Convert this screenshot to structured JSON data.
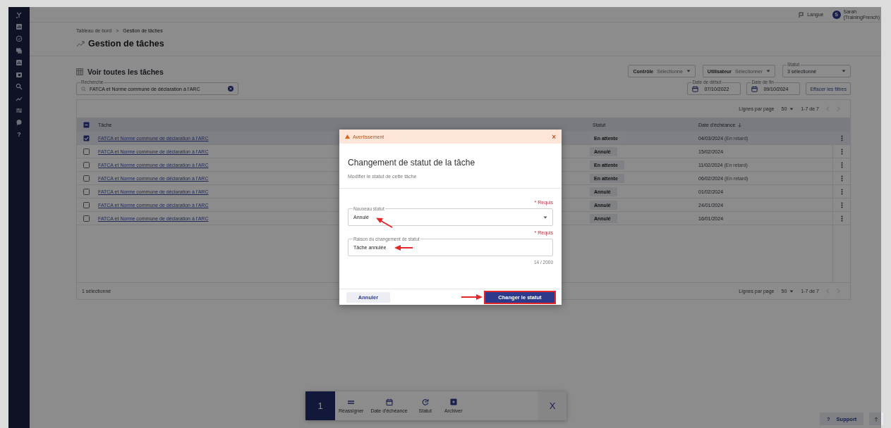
{
  "topbar": {
    "language": "Langue",
    "user": {
      "initial": "S",
      "name": "Sarah",
      "org": "(TrainingFrench)"
    }
  },
  "sidebar": {
    "help": "?"
  },
  "breadcrumb": {
    "items": [
      "Tableau de bord",
      "Gestion de tâches"
    ],
    "separator": ">"
  },
  "page_title": "Gestion de tâches",
  "section_title": "Voir toutes les tâches",
  "search": {
    "label": "Recherche",
    "value": "FATCA et Norme commune de déclaration à l'ARC"
  },
  "filters": [
    {
      "kind": "select",
      "label": "Contrôle",
      "value": "Sélectionne"
    },
    {
      "kind": "select",
      "label": "Utilisateur",
      "value": "Sélectionner"
    },
    {
      "kind": "floating",
      "label": "Statut",
      "value": "3 sélectionné"
    }
  ],
  "dates": [
    {
      "label": "Date de début",
      "value": "07/10/2022"
    },
    {
      "label": "Date de fin",
      "value": "09/10/2024"
    }
  ],
  "clear_filters": "Effacer les filtres",
  "table": {
    "pagination_top": {
      "rows_label": "Lignes par page",
      "rows_value": "50",
      "range": "1-7 de 7"
    },
    "header_partial": true,
    "columns": [
      "Tâche",
      "Statut",
      "Date d'échéance"
    ],
    "rows": [
      {
        "task": "FATCA et Norme commune de déclaration à l'ARC",
        "status": "En attente",
        "due": "04/03/2024",
        "late": "(En retard)",
        "selected": true
      },
      {
        "task": "FATCA et Norme commune de déclaration à l'ARC",
        "status": "Annulé",
        "due": "15/02/2024",
        "selected": false
      },
      {
        "task": "FATCA et Norme commune de déclaration à l'ARC",
        "status": "En attente",
        "due": "11/02/2024",
        "late": "(En retard)",
        "selected": false
      },
      {
        "task": "FATCA et Norme commune de déclaration à l'ARC",
        "status": "En attente",
        "due": "06/02/2024",
        "late": "(En retard)",
        "selected": false
      },
      {
        "task": "FATCA et Norme commune de déclaration à l'ARC",
        "status": "Annulé",
        "due": "01/02/2024",
        "selected": false
      },
      {
        "task": "FATCA et Norme commune de déclaration à l'ARC",
        "status": "Annulé",
        "due": "24/01/2024",
        "selected": false
      },
      {
        "task": "FATCA et Norme commune de déclaration à l'ARC",
        "status": "Annulé",
        "due": "16/01/2024",
        "selected": false
      }
    ],
    "selection_count": "1 sélectionné",
    "pagination_bottom": {
      "rows_label": "Lignes par page",
      "rows_value": "50",
      "range": "1-7 de 7"
    }
  },
  "action_bar": {
    "count": "1",
    "actions": [
      {
        "kind": "reassign",
        "label": "Réassigner"
      },
      {
        "kind": "due_date",
        "label": "Date d'échéance"
      },
      {
        "kind": "status",
        "label": "Statut"
      },
      {
        "kind": "archive",
        "label": "Archiver"
      }
    ],
    "close": "X"
  },
  "support": {
    "icon": "?",
    "label": "Support"
  },
  "modal": {
    "header": "Avertissement",
    "close": "×",
    "title": "Changement de statut de la tâche",
    "subtitle": "Modifier le statut de cette tâche",
    "fields": [
      {
        "kind": "select",
        "required": "* Requis",
        "label": "Nouveau statut",
        "value": "Annulé"
      },
      {
        "kind": "text",
        "required": "* Requis",
        "label": "Raison du changement de statut",
        "value": "Tâche annulée",
        "counter": "14 / 2000"
      }
    ],
    "cancel": "Annuler",
    "confirm": {
      "label": "Changer le statut",
      "highlighted": true
    }
  }
}
